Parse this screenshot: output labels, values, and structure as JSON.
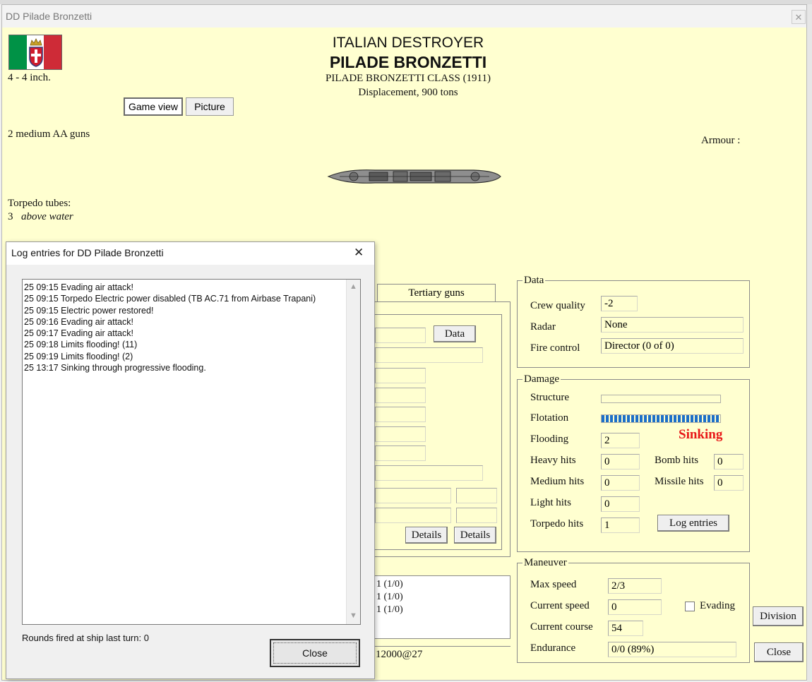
{
  "window": {
    "title": "DD Pilade Bronzetti",
    "close_glyph": "✕"
  },
  "ship": {
    "nationality": "ITALIAN DESTROYER",
    "name": "PILADE BRONZETTI",
    "class_line": "PILADE BRONZETTI CLASS (1911)",
    "displacement": "Displacement, 900 tons",
    "main_guns": "4 - 4 inch.",
    "aa_guns": "2 medium AA guns",
    "armour_label": "Armour :",
    "torpedo_label": "Torpedo tubes:",
    "torpedo_count": "3",
    "torpedo_type": "above water"
  },
  "flag": {
    "colors": [
      "#009246",
      "#ffffff",
      "#ce2b37"
    ]
  },
  "view_tabs": {
    "game_view": "Game view",
    "picture": "Picture"
  },
  "guns_tabs": {
    "tertiary": "Tertiary guns"
  },
  "guns_panel": {
    "data_button": "Data",
    "details_button_1": "Details",
    "details_button_2": "Details",
    "list_lines": [
      "1 (1/0)",
      "1 (1/0)",
      "1 (1/0)"
    ],
    "bottom_text": "12000@27"
  },
  "data_group": {
    "title": "Data",
    "crew_quality_label": "Crew quality",
    "crew_quality_value": "-2",
    "radar_label": "Radar",
    "radar_value": "None",
    "fire_control_label": "Fire control",
    "fire_control_value": "Director (0 of 0)"
  },
  "damage_group": {
    "title": "Damage",
    "structure_label": "Structure",
    "structure_fraction": 0,
    "flotation_label": "Flotation",
    "flotation_fraction": 1.0,
    "flooding_label": "Flooding",
    "flooding_value": "2",
    "status_text": "Sinking",
    "status_color": "#e81818",
    "heavy_hits_label": "Heavy hits",
    "heavy_hits_value": "0",
    "medium_hits_label": "Medium hits",
    "medium_hits_value": "0",
    "light_hits_label": "Light hits",
    "light_hits_value": "0",
    "torpedo_hits_label": "Torpedo hits",
    "torpedo_hits_value": "1",
    "bomb_hits_label": "Bomb hits",
    "bomb_hits_value": "0",
    "missile_hits_label": "Missile hits",
    "missile_hits_value": "0",
    "log_entries_button": "Log entries"
  },
  "maneuver_group": {
    "title": "Maneuver",
    "max_speed_label": "Max speed",
    "max_speed_value": "2/3",
    "current_speed_label": "Current speed",
    "current_speed_value": "0",
    "evading_label": "Evading",
    "current_course_label": "Current course",
    "current_course_value": "54",
    "endurance_label": "Endurance",
    "endurance_value": "0/0 (89%)"
  },
  "buttons": {
    "division": "Division",
    "close": "Close"
  },
  "log_dialog": {
    "title": "Log entries for DD Pilade Bronzetti",
    "close_glyph": "✕",
    "entries": [
      "25 09:15  Evading air attack!",
      "25 09:15  Torpedo  Electric power disabled (TB AC.71 from Airbase Trapani)",
      "25 09:15  Electric power restored!",
      "25 09:16  Evading air attack!",
      "25 09:17  Evading air attack!",
      "25 09:18  Limits flooding! (11)",
      "25 09:19  Limits flooding! (2)",
      "25 13:17  Sinking through progressive flooding."
    ],
    "rounds_text": "Rounds fired at ship last turn: 0",
    "close_button": "Close",
    "scroll_up_glyph": "▲",
    "scroll_down_glyph": "▼"
  }
}
